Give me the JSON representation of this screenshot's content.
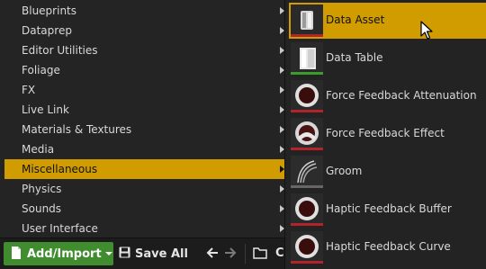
{
  "left_menu": {
    "items": [
      {
        "label": "Blueprints",
        "has_submenu": true
      },
      {
        "label": "Dataprep",
        "has_submenu": true
      },
      {
        "label": "Editor Utilities",
        "has_submenu": true
      },
      {
        "label": "Foliage",
        "has_submenu": true
      },
      {
        "label": "FX",
        "has_submenu": true
      },
      {
        "label": "Live Link",
        "has_submenu": true
      },
      {
        "label": "Materials & Textures",
        "has_submenu": true
      },
      {
        "label": "Media",
        "has_submenu": true
      },
      {
        "label": "Miscellaneous",
        "has_submenu": true,
        "active": true
      },
      {
        "label": "Physics",
        "has_submenu": true
      },
      {
        "label": "Sounds",
        "has_submenu": true
      },
      {
        "label": "User Interface",
        "has_submenu": true
      }
    ]
  },
  "sub_menu": {
    "items": [
      {
        "label": "Data Asset",
        "icon": "data-asset-icon",
        "stripe": "#b0242a",
        "active": true
      },
      {
        "label": "Data Table",
        "icon": "data-table-icon",
        "stripe": "#3c9a2f"
      },
      {
        "label": "Force Feedback Attenuation",
        "icon": "force-feedback-attenuation-icon",
        "stripe": "#b0242a"
      },
      {
        "label": "Force Feedback Effect",
        "icon": "force-feedback-effect-icon",
        "stripe": "#b0242a"
      },
      {
        "label": "Groom",
        "icon": "groom-icon",
        "stripe": "#666666"
      },
      {
        "label": "Haptic Feedback Buffer",
        "icon": "haptic-feedback-buffer-icon",
        "stripe": "#b0242a"
      },
      {
        "label": "Haptic Feedback Curve",
        "icon": "haptic-feedback-curve-icon",
        "stripe": "#b0242a"
      }
    ]
  },
  "toolbar": {
    "add_import_label": "Add/Import",
    "save_all_label": "Save All",
    "trailing_text": "C"
  },
  "colors": {
    "highlight": "#d09c00",
    "add_button": "#3f8d2f",
    "menu_bg": "#242424"
  }
}
